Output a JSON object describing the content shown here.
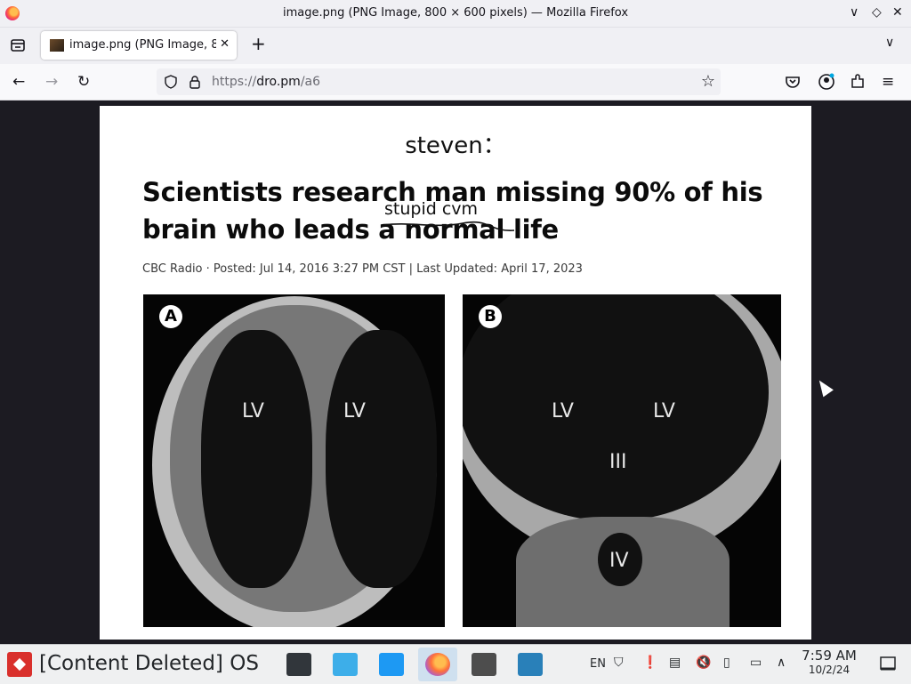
{
  "window": {
    "title": "image.png (PNG Image, 800 × 600 pixels) — Mozilla Firefox",
    "ctl_min": "∨",
    "ctl_max": "◇",
    "ctl_close": "✕"
  },
  "tabs": [
    {
      "label": "image.png (PNG Image, 800 × 600 pixels)",
      "close": "✕"
    }
  ],
  "new_tab": "+",
  "tab_list": "∨",
  "nav": {
    "back": "←",
    "forward": "→",
    "reload": "↻",
    "url_proto": "https://",
    "url_host": "dro.pm",
    "url_path": "/a6",
    "bookmark": "☆",
    "menu": "≡"
  },
  "image": {
    "author": "steven：",
    "headline_1": "Scientists research man missing 90% of his",
    "headline_2_pre": "brain who leads a ",
    "headline_2_struck": "normal",
    "headline_2_post": " life",
    "annotation": "stupid cvm",
    "byline": "CBC Radio · Posted: Jul 14, 2016 3:27 PM CST | Last Updated: April 17, 2023",
    "scanA": {
      "letter": "A",
      "lv1": "LV",
      "lv2": "LV"
    },
    "scanB": {
      "letter": "B",
      "lv1": "LV",
      "lv2": "LV",
      "iii": "III",
      "iv": "IV"
    }
  },
  "taskbar": {
    "os_label": "[Content Deleted] OS",
    "lang": "EN",
    "time": "7:59 AM",
    "date": "10/2/24"
  }
}
